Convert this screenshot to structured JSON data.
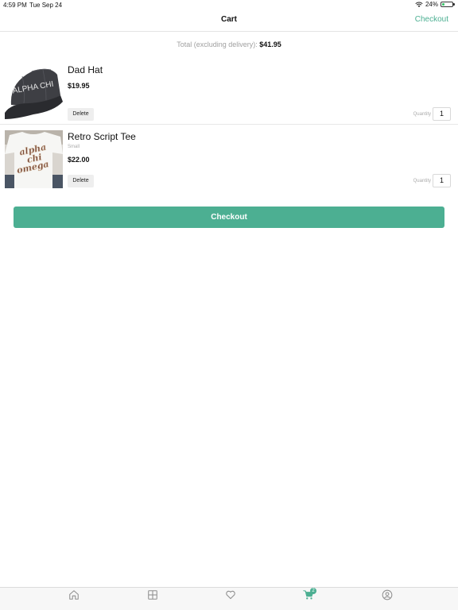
{
  "status_bar": {
    "time": "4:59 PM",
    "date": "Tue Sep 24",
    "battery": "24%",
    "battery_level": 0.24
  },
  "nav": {
    "title": "Cart",
    "checkout_link": "Checkout"
  },
  "cart": {
    "total_label": "Total (excluding delivery):",
    "total_value": "$41.95",
    "items": [
      {
        "name": "Dad Hat",
        "variant": "",
        "price": "$19.95",
        "image_text": "ALPHA CHI",
        "delete_label": "Delete",
        "quantity_label": "Quantity",
        "quantity": "1"
      },
      {
        "name": "Retro Script Tee",
        "variant": "Small",
        "price": "$22.00",
        "image_text": [
          "alpha",
          "chi",
          "omega"
        ],
        "delete_label": "Delete",
        "quantity_label": "Quantity",
        "quantity": "1"
      }
    ],
    "checkout_button": "Checkout"
  },
  "tab_bar": {
    "tabs": [
      {
        "icon": "home-icon"
      },
      {
        "icon": "grid-icon"
      },
      {
        "icon": "heart-icon"
      },
      {
        "icon": "cart-icon",
        "active": true,
        "badge": "2"
      },
      {
        "icon": "user-icon"
      }
    ]
  },
  "colors": {
    "accent": "#4caf92",
    "inactive_icon": "#8e8e8e"
  }
}
